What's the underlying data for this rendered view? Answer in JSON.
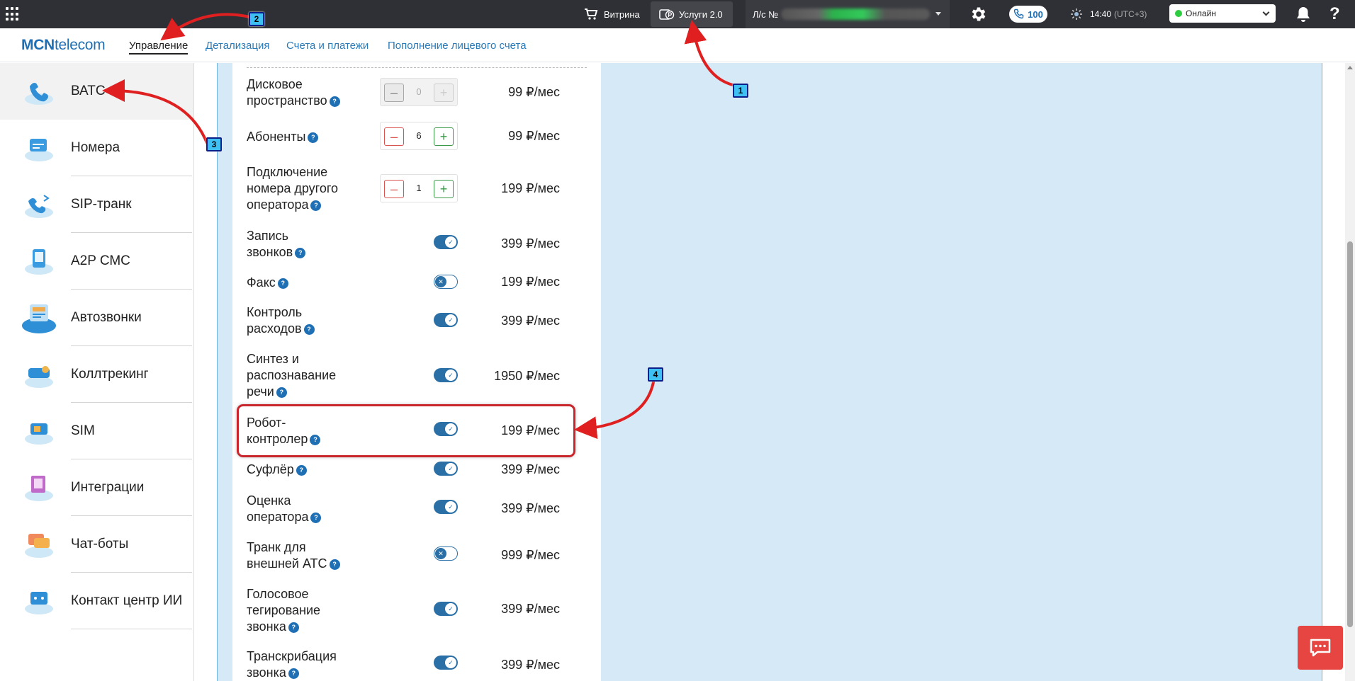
{
  "topbar": {
    "vitrina": "Витрина",
    "uslugi": "Услуги 2.0",
    "account_label": "Л/с №",
    "calls_count": "100",
    "time": "14:40",
    "timezone": "(UTC+3)",
    "status": "Онлайн",
    "help": "?"
  },
  "logo": {
    "bold": "MCN",
    "rest": "telecom"
  },
  "nav": [
    {
      "label": "Управление",
      "active": true
    },
    {
      "label": "Детализация"
    },
    {
      "label": "Счета и платежи"
    },
    {
      "label": "Пополнение лицевого счета"
    }
  ],
  "sidebar": [
    {
      "label": "ВАТС",
      "icon": "vats-icon",
      "active": true
    },
    {
      "label": "Номера",
      "icon": "numbers-icon"
    },
    {
      "label": "SIP-транк",
      "icon": "sip-trunk-icon"
    },
    {
      "label": "A2P СМС",
      "icon": "a2p-sms-icon"
    },
    {
      "label": "Автозвонки",
      "icon": "autocalls-icon"
    },
    {
      "label": "Коллтрекинг",
      "icon": "calltracking-icon"
    },
    {
      "label": "SIM",
      "icon": "sim-icon"
    },
    {
      "label": "Интеграции",
      "icon": "integrations-icon"
    },
    {
      "label": "Чат-боты",
      "icon": "chatbots-icon"
    },
    {
      "label": "Контакт центр ИИ",
      "icon": "ai-contact-center-icon"
    }
  ],
  "options": [
    {
      "name_lines": [
        "Дисковое",
        "пространство"
      ],
      "control": "stepper",
      "value": "0",
      "disabled": true,
      "price": "99 ₽/мес"
    },
    {
      "name_lines": [
        "Абоненты"
      ],
      "control": "stepper",
      "value": "6",
      "price": "99 ₽/мес"
    },
    {
      "name_lines": [
        "Подключение",
        "номера другого",
        "оператора"
      ],
      "control": "stepper",
      "value": "1",
      "price": "199 ₽/мес"
    },
    {
      "name_lines": [
        "Запись",
        "звонков"
      ],
      "control": "toggle",
      "on": true,
      "price": "399 ₽/мес"
    },
    {
      "name_lines": [
        "Факс"
      ],
      "control": "toggle",
      "on": false,
      "price": "199 ₽/мес"
    },
    {
      "name_lines": [
        "Контроль",
        "расходов"
      ],
      "control": "toggle",
      "on": true,
      "price": "399 ₽/мес"
    },
    {
      "name_lines": [
        "Синтез и",
        "распознавание",
        "речи"
      ],
      "control": "toggle",
      "on": true,
      "price": "1950 ₽/мес"
    },
    {
      "name_lines": [
        "Робот-",
        "контролер"
      ],
      "control": "toggle",
      "on": true,
      "price": "199 ₽/мес"
    },
    {
      "name_lines": [
        "Суфлёр"
      ],
      "control": "toggle",
      "on": true,
      "price": "399 ₽/мес"
    },
    {
      "name_lines": [
        "Оценка",
        "оператора"
      ],
      "control": "toggle",
      "on": true,
      "price": "399 ₽/мес"
    },
    {
      "name_lines": [
        "Транк для",
        "внешней АТС"
      ],
      "control": "toggle",
      "on": false,
      "price": "999 ₽/мес"
    },
    {
      "name_lines": [
        "Голосовое",
        "тегирование",
        "звонка"
      ],
      "control": "toggle",
      "on": true,
      "price": "399 ₽/мес"
    },
    {
      "name_lines": [
        "Транскрибация",
        "звонка"
      ],
      "control": "toggle",
      "on": true,
      "price": "399 ₽/мес"
    }
  ],
  "annotations": [
    "1",
    "2",
    "3",
    "4"
  ],
  "colors": {
    "accent": "#1f6fb5",
    "topbar": "#2f3035",
    "panel": "#d6e9f6",
    "annotation_red": "#e02020",
    "badge": "#3fc0f2"
  }
}
